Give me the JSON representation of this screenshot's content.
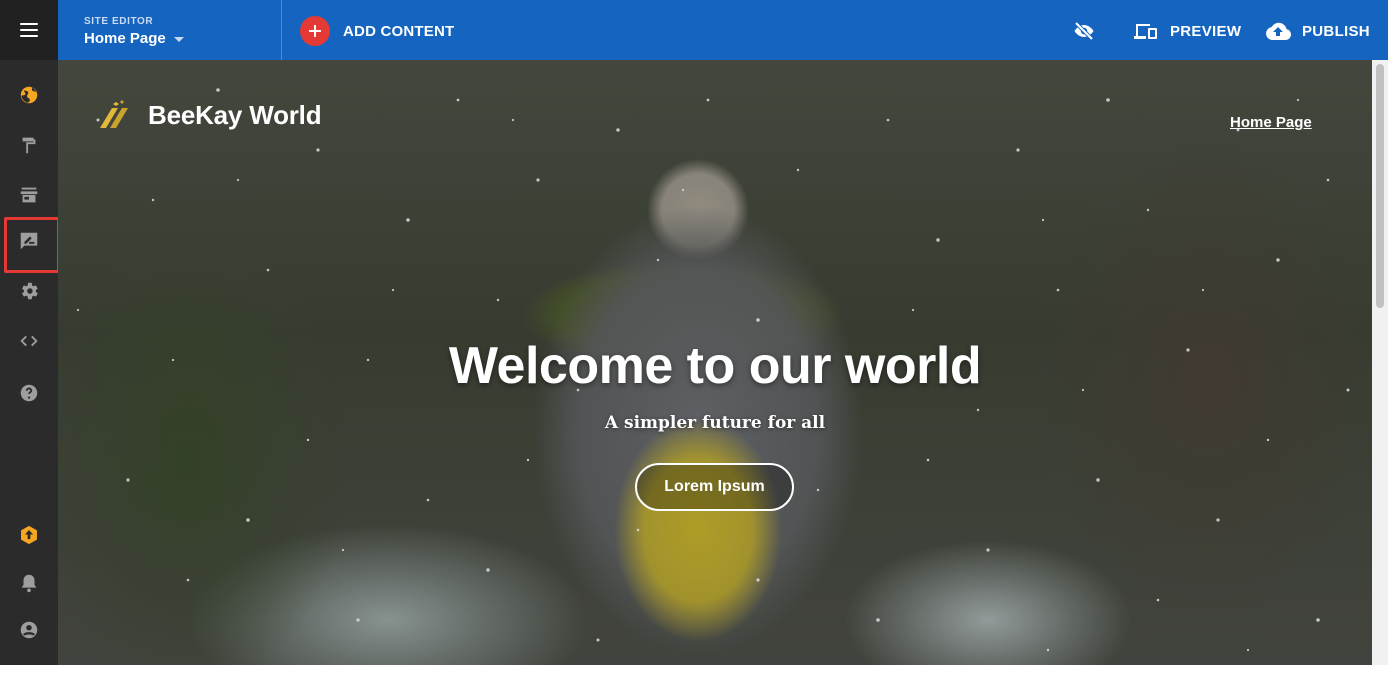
{
  "topbar": {
    "site_editor_label": "SITE EDITOR",
    "current_page": "Home Page",
    "add_content_label": "ADD CONTENT",
    "preview_label": "PREVIEW",
    "publish_label": "PUBLISH",
    "accent_color": "#1565c0",
    "add_color": "#e53935"
  },
  "sidebar": {
    "items": [
      {
        "icon": "globe-icon"
      },
      {
        "icon": "paint-roller-icon"
      },
      {
        "icon": "storefront-icon"
      },
      {
        "icon": "blog-post-icon",
        "highlighted": true
      },
      {
        "icon": "gear-icon"
      },
      {
        "icon": "code-icon"
      },
      {
        "icon": "help-icon"
      },
      {
        "icon": "upgrade-icon"
      },
      {
        "icon": "bell-icon"
      },
      {
        "icon": "account-icon"
      }
    ]
  },
  "site": {
    "brand_name": "BeeKay World",
    "nav_link": "Home Page",
    "hero_title": "Welcome to our world",
    "hero_subtitle": "A simpler future for all",
    "hero_button": "Lorem Ipsum"
  }
}
